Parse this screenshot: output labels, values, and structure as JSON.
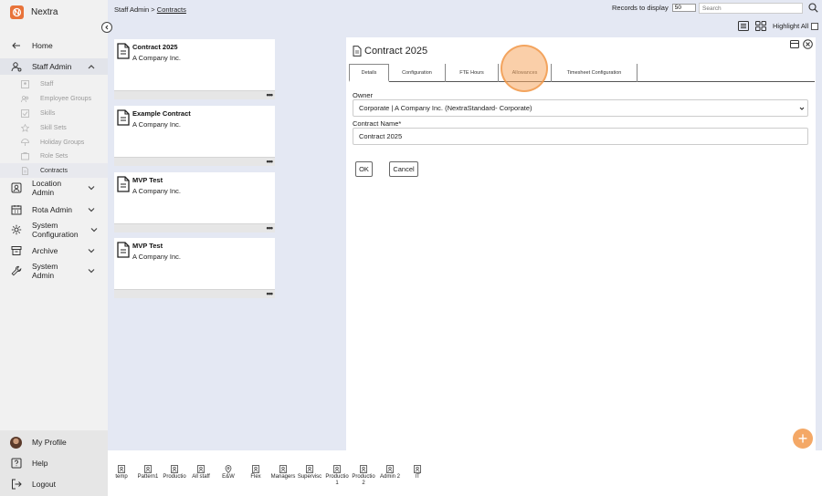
{
  "app": {
    "name": "Nextra"
  },
  "sidebar": {
    "items": [
      {
        "label": "Home"
      },
      {
        "label": "Staff Admin"
      },
      {
        "label": "Location\nAdmin"
      },
      {
        "label": "Rota Admin"
      },
      {
        "label": "System\nConfiguration"
      },
      {
        "label": "Archive"
      },
      {
        "label": "System\nAdmin"
      }
    ],
    "sub_items": [
      {
        "label": "Staff"
      },
      {
        "label": "Employee Groups"
      },
      {
        "label": "Skills"
      },
      {
        "label": "Skill Sets"
      },
      {
        "label": "Holiday Groups"
      },
      {
        "label": "Role Sets"
      },
      {
        "label": "Contracts"
      }
    ],
    "bottom": [
      {
        "label": "My Profile"
      },
      {
        "label": "Help"
      },
      {
        "label": "Logout"
      }
    ]
  },
  "header": {
    "breadcrumb_parent": "Staff Admin",
    "breadcrumb_sep": " > ",
    "breadcrumb_current": "Contracts",
    "records_label": "Records to display",
    "records_value": "50",
    "search_placeholder": "Search",
    "highlight_label": "Highlight All"
  },
  "cards": [
    {
      "title": "Contract 2025",
      "sub": "A Company Inc.",
      "more": "•••"
    },
    {
      "title": "Example Contract",
      "sub": "A Company Inc.",
      "more": "•••"
    },
    {
      "title": "MVP Test",
      "sub": "A Company Inc.",
      "more": "•••"
    },
    {
      "title": "MVP Test",
      "sub": "A Company Inc.",
      "more": "•••"
    }
  ],
  "panel": {
    "title": "Contract 2025",
    "tabs": [
      {
        "label": "Details"
      },
      {
        "label": "Configuration"
      },
      {
        "label": "FTE Hours"
      },
      {
        "label": "Allowances"
      },
      {
        "label": "Timesheet Configuration"
      }
    ],
    "owner_label": "Owner",
    "owner_value": "Corporate | A Company Inc. (NextraStandard- Corporate)",
    "name_label": "Contract Name*",
    "name_value": "Contract 2025",
    "ok_label": "OK",
    "cancel_label": "Cancel"
  },
  "tray": [
    {
      "label": "temp"
    },
    {
      "label": "Pattern1"
    },
    {
      "label": "Productio"
    },
    {
      "label": "All staff"
    },
    {
      "label": "E&W"
    },
    {
      "label": "Flex"
    },
    {
      "label": "Managers"
    },
    {
      "label": "Supervisc"
    },
    {
      "label": "Productio\n1"
    },
    {
      "label": "Productio\n2"
    },
    {
      "label": "Admin 2"
    },
    {
      "label": "IT"
    }
  ],
  "fab": {
    "label": "+"
  },
  "colors": {
    "accent": "#e8733a",
    "highlight": "#f6a862",
    "background": "#e4e8f3"
  }
}
